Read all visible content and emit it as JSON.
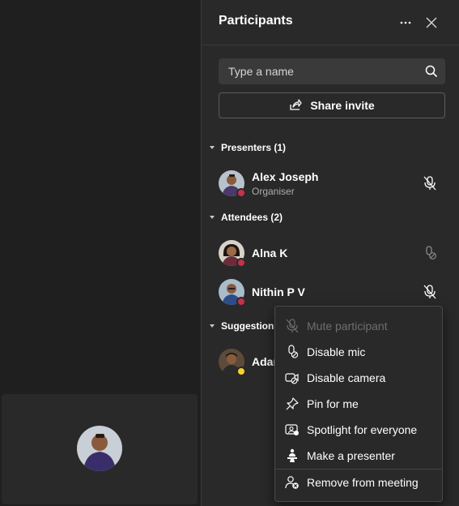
{
  "panel": {
    "title": "Participants",
    "more_label": "···",
    "search": {
      "placeholder": "Type a name"
    },
    "share_invite_label": "Share invite"
  },
  "sections": {
    "presenters": "Presenters (1)",
    "attendees": "Attendees (2)",
    "suggestions": "Suggestions"
  },
  "participants": {
    "presenter": {
      "name": "Alex Joseph",
      "role": "Organiser",
      "status": "busy",
      "mic": "muted"
    },
    "attendee_1": {
      "name": "Alna K",
      "status": "busy",
      "mic": "disabled"
    },
    "attendee_2": {
      "name": "Nithin P V",
      "status": "busy",
      "mic": "muted"
    },
    "suggestion_1": {
      "name": "Adar",
      "status": "away"
    }
  },
  "context_menu": {
    "items": [
      {
        "label": "Mute participant",
        "icon": "mic-off-icon",
        "enabled": false
      },
      {
        "label": "Disable mic",
        "icon": "mic-disable-icon",
        "enabled": true
      },
      {
        "label": "Disable camera",
        "icon": "camera-disable-icon",
        "enabled": true
      },
      {
        "label": "Pin for me",
        "icon": "pin-icon",
        "enabled": true
      },
      {
        "label": "Spotlight for everyone",
        "icon": "spotlight-icon",
        "enabled": true
      },
      {
        "label": "Make a presenter",
        "icon": "presenter-icon",
        "enabled": true
      },
      {
        "label": "Remove from meeting",
        "icon": "remove-person-icon",
        "enabled": true
      }
    ]
  },
  "colors": {
    "background": "#1f1f1f",
    "panel": "#292929",
    "busy_status": "#c4314b",
    "away_status": "#f8d22a"
  }
}
